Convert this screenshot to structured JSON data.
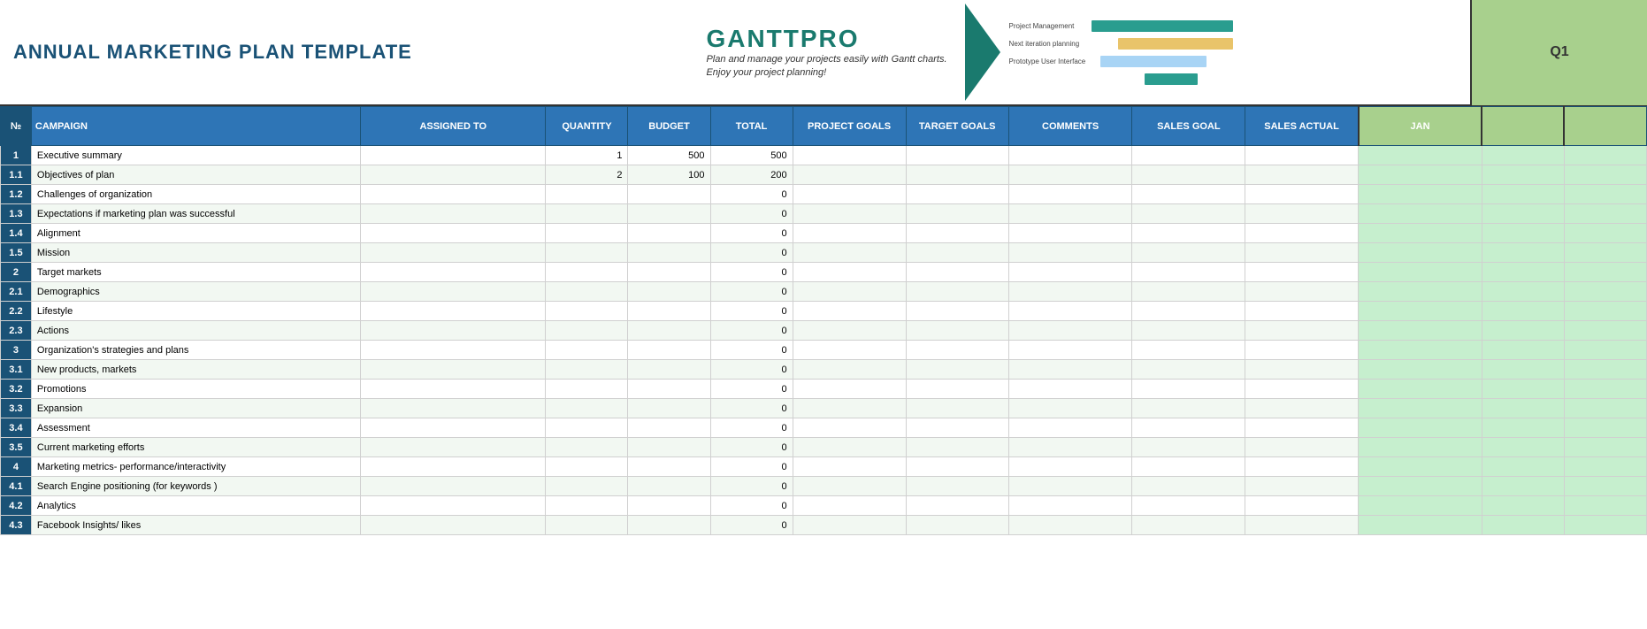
{
  "title": "ANNUAL MARKETING PLAN TEMPLATE",
  "banner": {
    "logo": "GANTTPRO",
    "tagline_line1": "Plan and manage your projects easily with Gantt charts.",
    "tagline_line2": "Enjoy your project planning!"
  },
  "q1_label": "Q1",
  "columns": {
    "no": "№",
    "campaign": "CAMPAIGN",
    "assigned_to": "ASSIGNED TO",
    "quantity": "QUANTITY",
    "budget": "BUDGET",
    "total": "TOTAL",
    "project_goals": "PROJECT GOALS",
    "target_goals": "TARGET GOALS",
    "comments": "COMMENTS",
    "sales_goal": "SALES GOAL",
    "sales_actual": "SALES ACTUAL",
    "jan": "JAN"
  },
  "rows": [
    {
      "no": "1",
      "campaign": "Executive summary",
      "assigned_to": "",
      "quantity": "1",
      "budget": "500",
      "total": "500",
      "project_goals": "",
      "target_goals": "",
      "comments": "",
      "sales_goal": "",
      "sales_actual": ""
    },
    {
      "no": "1.1",
      "campaign": "Objectives of plan",
      "assigned_to": "",
      "quantity": "2",
      "budget": "100",
      "total": "200",
      "project_goals": "",
      "target_goals": "",
      "comments": "",
      "sales_goal": "",
      "sales_actual": ""
    },
    {
      "no": "1.2",
      "campaign": "Challenges of organization",
      "assigned_to": "",
      "quantity": "",
      "budget": "",
      "total": "0",
      "project_goals": "",
      "target_goals": "",
      "comments": "",
      "sales_goal": "",
      "sales_actual": ""
    },
    {
      "no": "1.3",
      "campaign": "Expectations if marketing plan was successful",
      "assigned_to": "",
      "quantity": "",
      "budget": "",
      "total": "0",
      "project_goals": "",
      "target_goals": "",
      "comments": "",
      "sales_goal": "",
      "sales_actual": ""
    },
    {
      "no": "1.4",
      "campaign": "Alignment",
      "assigned_to": "",
      "quantity": "",
      "budget": "",
      "total": "0",
      "project_goals": "",
      "target_goals": "",
      "comments": "",
      "sales_goal": "",
      "sales_actual": ""
    },
    {
      "no": "1.5",
      "campaign": "Mission",
      "assigned_to": "",
      "quantity": "",
      "budget": "",
      "total": "0",
      "project_goals": "",
      "target_goals": "",
      "comments": "",
      "sales_goal": "",
      "sales_actual": ""
    },
    {
      "no": "2",
      "campaign": "Target markets",
      "assigned_to": "",
      "quantity": "",
      "budget": "",
      "total": "0",
      "project_goals": "",
      "target_goals": "",
      "comments": "",
      "sales_goal": "",
      "sales_actual": ""
    },
    {
      "no": "2.1",
      "campaign": "Demographics",
      "assigned_to": "",
      "quantity": "",
      "budget": "",
      "total": "0",
      "project_goals": "",
      "target_goals": "",
      "comments": "",
      "sales_goal": "",
      "sales_actual": ""
    },
    {
      "no": "2.2",
      "campaign": "Lifestyle",
      "assigned_to": "",
      "quantity": "",
      "budget": "",
      "total": "0",
      "project_goals": "",
      "target_goals": "",
      "comments": "",
      "sales_goal": "",
      "sales_actual": ""
    },
    {
      "no": "2.3",
      "campaign": "Actions",
      "assigned_to": "",
      "quantity": "",
      "budget": "",
      "total": "0",
      "project_goals": "",
      "target_goals": "",
      "comments": "",
      "sales_goal": "",
      "sales_actual": ""
    },
    {
      "no": "3",
      "campaign": "Organization's strategies and plans",
      "assigned_to": "",
      "quantity": "",
      "budget": "",
      "total": "0",
      "project_goals": "",
      "target_goals": "",
      "comments": "",
      "sales_goal": "",
      "sales_actual": ""
    },
    {
      "no": "3.1",
      "campaign": "New products, markets",
      "assigned_to": "",
      "quantity": "",
      "budget": "",
      "total": "0",
      "project_goals": "",
      "target_goals": "",
      "comments": "",
      "sales_goal": "",
      "sales_actual": ""
    },
    {
      "no": "3.2",
      "campaign": "Promotions",
      "assigned_to": "",
      "quantity": "",
      "budget": "",
      "total": "0",
      "project_goals": "",
      "target_goals": "",
      "comments": "",
      "sales_goal": "",
      "sales_actual": ""
    },
    {
      "no": "3.3",
      "campaign": "Expansion",
      "assigned_to": "",
      "quantity": "",
      "budget": "",
      "total": "0",
      "project_goals": "",
      "target_goals": "",
      "comments": "",
      "sales_goal": "",
      "sales_actual": ""
    },
    {
      "no": "3.4",
      "campaign": "Assessment",
      "assigned_to": "",
      "quantity": "",
      "budget": "",
      "total": "0",
      "project_goals": "",
      "target_goals": "",
      "comments": "",
      "sales_goal": "",
      "sales_actual": ""
    },
    {
      "no": "3.5",
      "campaign": "Current marketing efforts",
      "assigned_to": "",
      "quantity": "",
      "budget": "",
      "total": "0",
      "project_goals": "",
      "target_goals": "",
      "comments": "",
      "sales_goal": "",
      "sales_actual": ""
    },
    {
      "no": "4",
      "campaign": "Marketing metrics- performance/interactivity",
      "assigned_to": "",
      "quantity": "",
      "budget": "",
      "total": "0",
      "project_goals": "",
      "target_goals": "",
      "comments": "",
      "sales_goal": "",
      "sales_actual": ""
    },
    {
      "no": "4.1",
      "campaign": "Search Engine positioning (for keywords )",
      "assigned_to": "",
      "quantity": "",
      "budget": "",
      "total": "0",
      "project_goals": "",
      "target_goals": "",
      "comments": "",
      "sales_goal": "",
      "sales_actual": ""
    },
    {
      "no": "4.2",
      "campaign": "Analytics",
      "assigned_to": "",
      "quantity": "",
      "budget": "",
      "total": "0",
      "project_goals": "",
      "target_goals": "",
      "comments": "",
      "sales_goal": "",
      "sales_actual": ""
    },
    {
      "no": "4.3",
      "campaign": "Facebook Insights/ likes",
      "assigned_to": "",
      "quantity": "",
      "budget": "",
      "total": "0",
      "project_goals": "",
      "target_goals": "",
      "comments": "",
      "sales_goal": "",
      "sales_actual": ""
    }
  ]
}
